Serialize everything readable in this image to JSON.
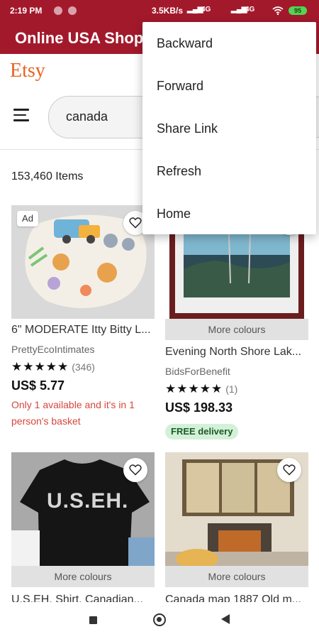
{
  "status_bar": {
    "time": "2:19 PM",
    "net_speed": "3.5KB/s",
    "net1": "4G",
    "net2": "4G",
    "battery": "95"
  },
  "app": {
    "title": "Online USA Shop"
  },
  "etsy": {
    "logo": "Etsy"
  },
  "search": {
    "query": "canada"
  },
  "results": {
    "count": "153,460 Items"
  },
  "products": [
    {
      "title": "6\" MODERATE Itty Bitty L...",
      "shop": "PrettyEcoIntimates",
      "stars": "★★★★★",
      "review_count": "(346)",
      "price": "US$ 5.77",
      "scarcity": "Only 1 available and it's in 1 person's basket",
      "badge": "Ad"
    },
    {
      "title": "Evening North Shore Lak...",
      "shop": "BidsForBenefit",
      "stars": "★★★★★",
      "review_count": "(1)",
      "price": "US$ 198.33",
      "more_colours": "More colours",
      "free_delivery": "FREE delivery"
    },
    {
      "title": "U.S.EH. Shirt, Canadian...",
      "more_colours": "More colours",
      "shirt_text": "U.S.EH."
    },
    {
      "title": "Canada map 1887 Old m...",
      "more_colours": "More colours"
    }
  ],
  "menu": {
    "items": [
      "Backward",
      "Forward",
      "Share Link",
      "Refresh",
      "Home"
    ]
  },
  "colors": {
    "brand": "#a3192c",
    "etsy_orange": "#e5631f",
    "scarcity": "#d6463e",
    "free_delivery_bg": "#d3f1d7"
  },
  "icons": [
    "hamburger-icon",
    "heart-icon",
    "wifi-icon",
    "signal-icon",
    "battery-icon",
    "nav-recents-icon",
    "nav-home-icon",
    "nav-back-icon"
  ]
}
